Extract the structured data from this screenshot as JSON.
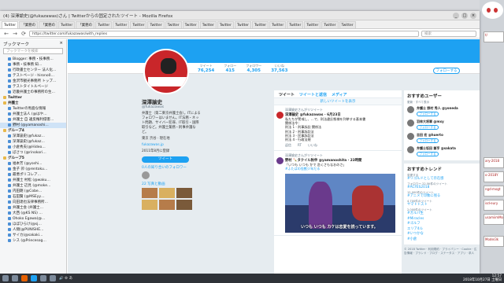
{
  "window": {
    "title": "(4) 深澤諭史(@fukazawas)さん | Twitterからの固定されたツイート - Mozilla Firefox",
    "buttons": [
      "_",
      "□",
      "×"
    ]
  },
  "tabs": [
    "Twitter",
    "「業務の",
    "「業務の",
    "Twitter",
    "「業務の",
    "Twitter",
    "Twitter",
    "Twitter",
    "Twitter",
    "Twitter",
    "Twitter",
    "Twitter",
    "Twitter",
    "Twitter",
    "Twitter",
    "Twitter",
    "Twitter",
    "Twitter",
    "Twitter",
    "Twitter"
  ],
  "nav": {
    "back": "←",
    "forward": "→",
    "reload": "⟳",
    "url": "https://twitter.com/fukazawas/with_replies",
    "search_placeholder": "検索"
  },
  "sidebar": {
    "title": "ブックマーク",
    "close": "×",
    "search_placeholder": "ブックマークを検索",
    "items": [
      {
        "label": "Blogger: 事務・技事務…",
        "type": "link"
      },
      {
        "label": "事務・技事務 知…",
        "type": "link"
      },
      {
        "label": "行政書士センター 法人化…",
        "type": "link"
      },
      {
        "label": "テストページ - hirono0…",
        "type": "link"
      },
      {
        "label": "金沢市観光事務所 トップ…",
        "type": "link"
      },
      {
        "label": "テストタイトルページ",
        "type": "link"
      },
      {
        "label": "近畿弁護士の事務所の生…",
        "type": "link"
      },
      {
        "label": "Twitter",
        "type": "folder"
      },
      {
        "label": "弁護士",
        "type": "folder"
      },
      {
        "label": "Twitterの馬鹿な情報",
        "type": "link"
      },
      {
        "label": "弁護士法人 (@はや…",
        "type": "link"
      },
      {
        "label": "弁護士 自 違反権利侵害…",
        "type": "link"
      },
      {
        "label": "野村 (@yamanoshi…",
        "type": "link",
        "selected": true
      },
      {
        "label": "グループ4",
        "type": "folder"
      },
      {
        "label": "深澤諭史(@fukaz…",
        "type": "link"
      },
      {
        "label": "深澤諭史(@fukaz…",
        "type": "link"
      },
      {
        "label": "小倉秀夫(@Hideo…",
        "type": "link"
      },
      {
        "label": "ぼさつ (@rinokori…",
        "type": "link"
      },
      {
        "label": "グループ5",
        "type": "folder"
      },
      {
        "label": "福本芳 (@yoshi…",
        "type": "link"
      },
      {
        "label": "金子 卯 (@rentoku…",
        "type": "link"
      },
      {
        "label": "最悪ポリコレア…",
        "type": "link"
      },
      {
        "label": "弁護士 村松 (@waku…",
        "type": "link"
      },
      {
        "label": "弁護士 辺見 (@moke…",
        "type": "link"
      },
      {
        "label": "内田朗 (@Cobe…",
        "type": "link"
      },
      {
        "label": "石田賢 (@MSEyy…",
        "type": "link"
      },
      {
        "label": "向田達也法律事務所…",
        "type": "link"
      },
      {
        "label": "弁護士会 (弁護士…",
        "type": "link"
      },
      {
        "label": "大西 (@KS NS) …",
        "type": "link"
      },
      {
        "label": "Ohoko Egawa(@…",
        "type": "link"
      },
      {
        "label": "ほぼひらけ(@sj…",
        "type": "link"
      },
      {
        "label": "人間(@PUNISHE…",
        "type": "link"
      },
      {
        "label": "サイカ(@sakaki…",
        "type": "link"
      },
      {
        "label": "シス (@Priecesog…",
        "type": "link"
      }
    ]
  },
  "profile": {
    "name": "深澤諭史",
    "handle": "@fukazawas",
    "bio": "弁護士（第二東京弁護士会）。ITによるフォロワーはいません。IT法務・ネット問題、サイバー犯罪、IT取引・国際取引など。弁護士業務・刑事弁護など。",
    "location": "東京 渋谷 · 現在地",
    "site": "fukazawas.jp",
    "joined": "2011年8月に登録",
    "tweet_button": "ツイート",
    "followers_you_know": "0人の知り合いのフォロワー",
    "media_label": "22 写真と動画"
  },
  "stats": [
    {
      "label": "ツイート",
      "value": "76,254"
    },
    {
      "label": "フォロー",
      "value": "415"
    },
    {
      "label": "フォロワー",
      "value": "4,305"
    },
    {
      "label": "いいね",
      "value": "37,563"
    }
  ],
  "follow_button": "フォローする",
  "timeline": {
    "tabs": [
      "ツイート",
      "ツイートと返信",
      "メディア"
    ],
    "new_tweets": "新しいツイートを表示",
    "tweets": [
      {
        "context": "深澤諭史さんがリツイート",
        "author": "深澤諭史 @fukazawas · 6月23日",
        "text": "私たちが警戒し、…で、刑法違反態様を列挙する基本書\n関係法令：\n刑法 1 - 刑事訴訟 関係法\n刑法 2 - 刑事訴訟法\n刑法 3 - 民事訴訟法\n刑法 4 - 行政法規"
      },
      {
        "context": "深澤諭史さんがリツイート",
        "author": "野村 🍡タクイル秋申 @yamanoshita · 23時間",
        "text": "「いつも いつも かで 恋くさもなおのさ」",
        "link": "#ふたばの怪獣少年だる",
        "caption": "いつも いつも カケは恋愛を読っています。"
      }
    ],
    "actions": [
      "返信",
      "RT",
      "いいね"
    ]
  },
  "recommended": {
    "title": "おすすめユーザー",
    "refresh": "更新 · すべて表示",
    "users": [
      {
        "name": "弁護士 野村 秀人 @yoneda",
        "button": "フォローする"
      },
      {
        "name": "羽林大将軍 @mxy",
        "button": "フォローする"
      },
      {
        "name": "吉田 宏 @huerto",
        "button": "フォローする"
      },
      {
        "name": "弁護士坂田 兼亨 @sakata",
        "button": "フォローする"
      }
    ]
  },
  "trends": {
    "title": "おすすめトレンド",
    "change": "変更する",
    "items": [
      {
        "tag": "#リゴルドとして存在感",
        "meta": "フォロワー 22.5K件のツイート"
      },
      {
        "tag": "#ACFES2018",
        "meta": "12,000件のツイート"
      },
      {
        "tag": "#アニメで印象に残る",
        "meta": "4,700件のツイート"
      },
      {
        "tag": "ヤマトトスト",
        "meta": "2,000件のツイート"
      },
      {
        "tag": "#ガルパ生",
        "meta": ""
      },
      {
        "tag": "#Miracles",
        "meta": ""
      },
      {
        "tag": "#ゴルフ",
        "meta": ""
      },
      {
        "tag": "エリア4ル",
        "meta": ""
      },
      {
        "tag": "#いつかな",
        "meta": ""
      },
      {
        "tag": "#小倉",
        "meta": ""
      }
    ],
    "footer": "© 2018 Twitter · 利用規約 · プライバシー · Cookie · 広告情報 · ブランド · ブログ · ステータス · アプリ · 求人"
  },
  "desktop": {
    "snips": [
      "t/",
      "ary-2018",
      "o-2018Y",
      "ngd-mogt",
      "isd-eury",
      "usamiimMosan",
      "Mode/3k"
    ]
  },
  "taskbar": {
    "time": "12:57",
    "date": "2018年10月27日 土曜日",
    "tray": "🔊 ⚙ あ"
  },
  "colors": {
    "twitter_blue": "#1da1f2",
    "profile_red": "#c9262a",
    "taskbar": "#2e3238"
  }
}
